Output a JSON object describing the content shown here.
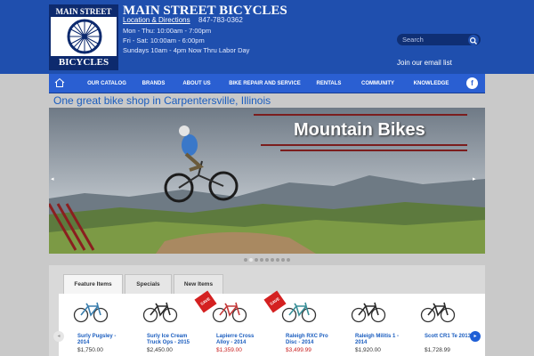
{
  "header": {
    "logo_top": "MAIN STREET",
    "logo_bottom": "BICYCLES",
    "site_title": "MAIN STREET BICYCLES",
    "location_link": "Location & Directions",
    "phone": "847-783-0362",
    "hours": [
      "Mon - Thu: 10:00am - 7:00pm",
      "Fri - Sat: 10:00am - 6:00pm",
      "Sundays 10am - 4pm Now Thru Labor Day"
    ],
    "search_placeholder": "Search",
    "email_link": "Join our email list"
  },
  "nav": {
    "home_icon": "home-icon",
    "items": [
      "OUR CATALOG",
      "BRANDS",
      "ABOUT US",
      "BIKE REPAIR AND SERVICE",
      "RENTALS",
      "COMMUNITY",
      "KNOWLEDGE"
    ],
    "facebook": "f"
  },
  "tagline": "One great bike shop in Carpentersville, Illinois",
  "hero": {
    "title": "Mountain Bikes",
    "prev": "◂",
    "next": "▸",
    "slide_count": 9,
    "active_slide": 1
  },
  "products": {
    "tabs": [
      "Feature Items",
      "Specials",
      "New Items"
    ],
    "active_tab": 0,
    "prev": "◂",
    "next": "▸",
    "items": [
      {
        "name": "Surly Pugsley - 2014",
        "price": "$1,750.00",
        "sale": false,
        "bike_color": "#3b7fae"
      },
      {
        "name": "Surly Ice Cream Truck Ops - 2015",
        "price": "$2,450.00",
        "sale": false,
        "bike_color": "#2b2b2b"
      },
      {
        "name": "Lapierre Cross Alloy - 2014",
        "price": "$1,359.00",
        "sale": true,
        "badge": "SAVE",
        "bike_color": "#c43a3a"
      },
      {
        "name": "Raleigh RXC Pro Disc - 2014",
        "price": "$3,499.99",
        "sale": true,
        "badge": "SAVE",
        "bike_color": "#3a8f98"
      },
      {
        "name": "Raleigh Militis 1 - 2014",
        "price": "$1,920.00",
        "sale": false,
        "bike_color": "#2b2b2b"
      },
      {
        "name": "Scott CR1 Te 2013",
        "price": "$1,728.99",
        "sale": false,
        "bike_color": "#2b2b2b"
      }
    ]
  }
}
